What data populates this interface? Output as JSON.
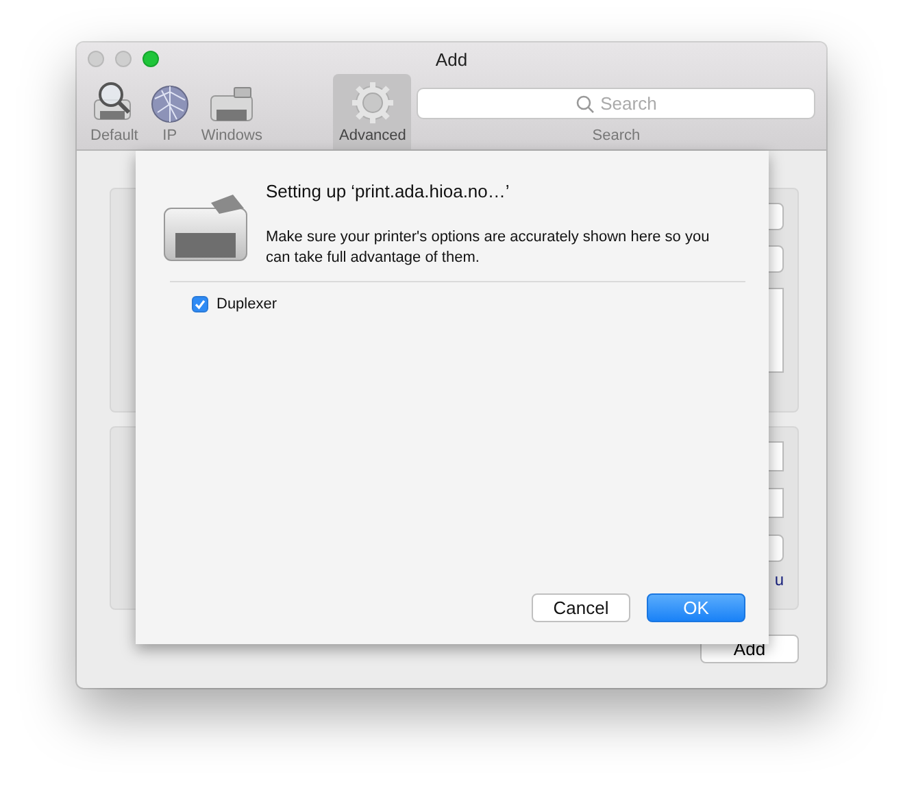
{
  "window": {
    "title": "Add"
  },
  "toolbar": {
    "items": [
      {
        "label": "Default",
        "kind": "default",
        "selected": false
      },
      {
        "label": "IP",
        "kind": "ip",
        "selected": false
      },
      {
        "label": "Windows",
        "kind": "windows",
        "selected": false
      },
      {
        "label": "Advanced",
        "kind": "advanced",
        "selected": true
      }
    ],
    "search": {
      "placeholder": "Search",
      "label": "Search"
    }
  },
  "background": {
    "cut_text": "u",
    "add_button": "Add"
  },
  "sheet": {
    "title": "Setting up ‘print.ada.hioa.no…’",
    "message": "Make sure your printer's options are accurately shown here so you can take full advantage of them.",
    "options": [
      {
        "label": "Duplexer",
        "checked": true
      }
    ],
    "buttons": [
      {
        "label": "Cancel",
        "default": false
      },
      {
        "label": "OK",
        "default": true
      }
    ]
  }
}
